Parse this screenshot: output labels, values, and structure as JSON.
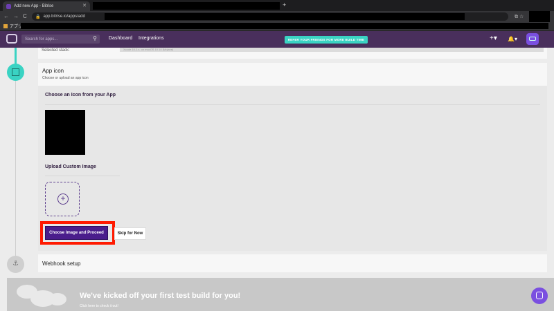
{
  "browser": {
    "tab_title": "Add new App - Bitrise",
    "tab_close": "✕",
    "new_tab": "+",
    "url": "app.bitrise.io/apps/add",
    "back": "←",
    "forward": "→",
    "reload": "C",
    "bookmark_label": "アプリ"
  },
  "header": {
    "search_placeholder": "Search for apps...",
    "nav_dashboard": "Dashboard",
    "nav_integrations": "Integrations",
    "promo_text": "REFER YOUR FRIENDS FOR MORE BUILD TIME",
    "add_glyph": "+▾",
    "bell_glyph": "🔔▾"
  },
  "top_card": {
    "label": "Selected stack:",
    "field_text": "Xcode 10.2.x, on macOS 10.14 (Mojave)"
  },
  "app_icon": {
    "title": "App icon",
    "subtitle": "Choose or upload an app icon",
    "choose_heading": "Choose an Icon from your App",
    "upload_heading": "Upload Custom Image",
    "plus_glyph": "+",
    "primary_button": "Choose Image and Proceed",
    "skip_button": "Skip for Now"
  },
  "webhook": {
    "title": "Webhook setup"
  },
  "banner": {
    "title": "We've kicked off your first test build for you!",
    "subtitle": "Click here to check it out!"
  },
  "colors": {
    "accent_teal": "#3ad3c3",
    "brand_purple": "#492f5c",
    "button_purple": "#4a1d8c",
    "highlight_red": "#ff1a00"
  }
}
